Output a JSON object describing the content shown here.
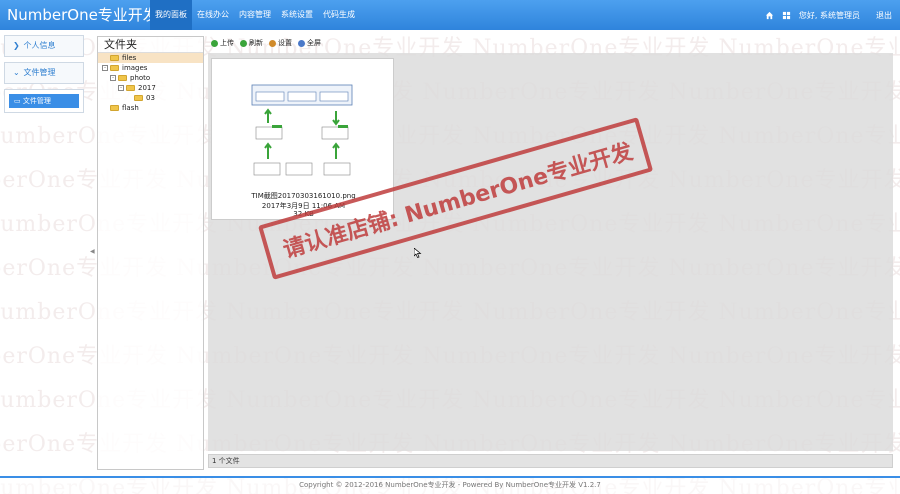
{
  "header": {
    "brand": "NumberOne专业开发",
    "nav": [
      "我的面板",
      "在线办公",
      "内容管理",
      "系统设置",
      "代码生成"
    ],
    "active_nav": 0,
    "greeting": "您好, 系统管理员",
    "logout": "退出",
    "icons": [
      "home-icon",
      "grid-icon"
    ]
  },
  "sidebar": {
    "groups": [
      {
        "label": "个人信息",
        "icon": "chevron-right-icon"
      },
      {
        "label": "文件管理",
        "icon": "chevron-down-icon"
      }
    ],
    "active_item": "文件管理"
  },
  "folder_panel": {
    "title": "文件夹",
    "tree": [
      {
        "name": "files",
        "depth": 0,
        "toggle": "",
        "selected": true
      },
      {
        "name": "images",
        "depth": 0,
        "toggle": "-",
        "selected": false
      },
      {
        "name": "photo",
        "depth": 1,
        "toggle": "-",
        "selected": false
      },
      {
        "name": "2017",
        "depth": 2,
        "toggle": "-",
        "selected": false
      },
      {
        "name": "03",
        "depth": 3,
        "toggle": "",
        "selected": false
      },
      {
        "name": "flash",
        "depth": 0,
        "toggle": "",
        "selected": false
      }
    ]
  },
  "toolbar": {
    "buttons": [
      {
        "label": "上传",
        "icon": "upload-icon",
        "color": "#3aa43a"
      },
      {
        "label": "刷新",
        "icon": "refresh-icon",
        "color": "#3aa43a"
      },
      {
        "label": "设置",
        "icon": "settings-icon",
        "color": "#d08a2a"
      },
      {
        "label": "全屏",
        "icon": "fullscreen-icon",
        "color": "#4a78c8"
      }
    ]
  },
  "files": [
    {
      "name": "TIM截图20170303161010.png",
      "date": "2017年3月9日 11:06 AM",
      "size": "32 KB"
    }
  ],
  "status": "1 个文件",
  "stamp": "请认准店铺: NumberOne专业开发",
  "watermark": "NumberOne专业开发",
  "footer": "Copyright © 2012-2016 NumberOne专业开发 - Powered By NumberOne专业开发 V1.2.7",
  "colors": {
    "accent": "#3a8ee6",
    "stamp": "#be3c3c"
  }
}
